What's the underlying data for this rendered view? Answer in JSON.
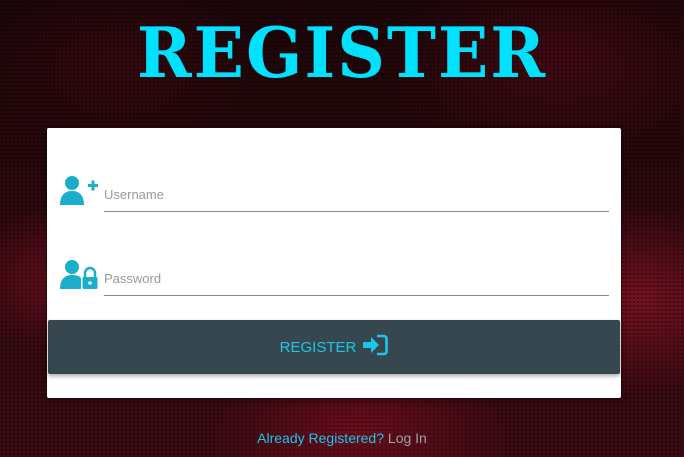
{
  "page": {
    "title": "REGISTER"
  },
  "form": {
    "username": {
      "placeholder": "Username",
      "value": "",
      "icon": "user-plus-icon"
    },
    "password": {
      "placeholder": "Password",
      "value": "",
      "icon": "user-lock-icon"
    },
    "submit": {
      "label": "REGISTER",
      "icon": "sign-in-icon"
    }
  },
  "footer": {
    "question": "Already Registered?",
    "login_link": "Log In"
  },
  "colors": {
    "accent": "#00e1ff",
    "icon": "#1aaecb",
    "button_bg": "#37474f",
    "button_text": "#1ec6e6",
    "card_bg": "#ffffff"
  }
}
